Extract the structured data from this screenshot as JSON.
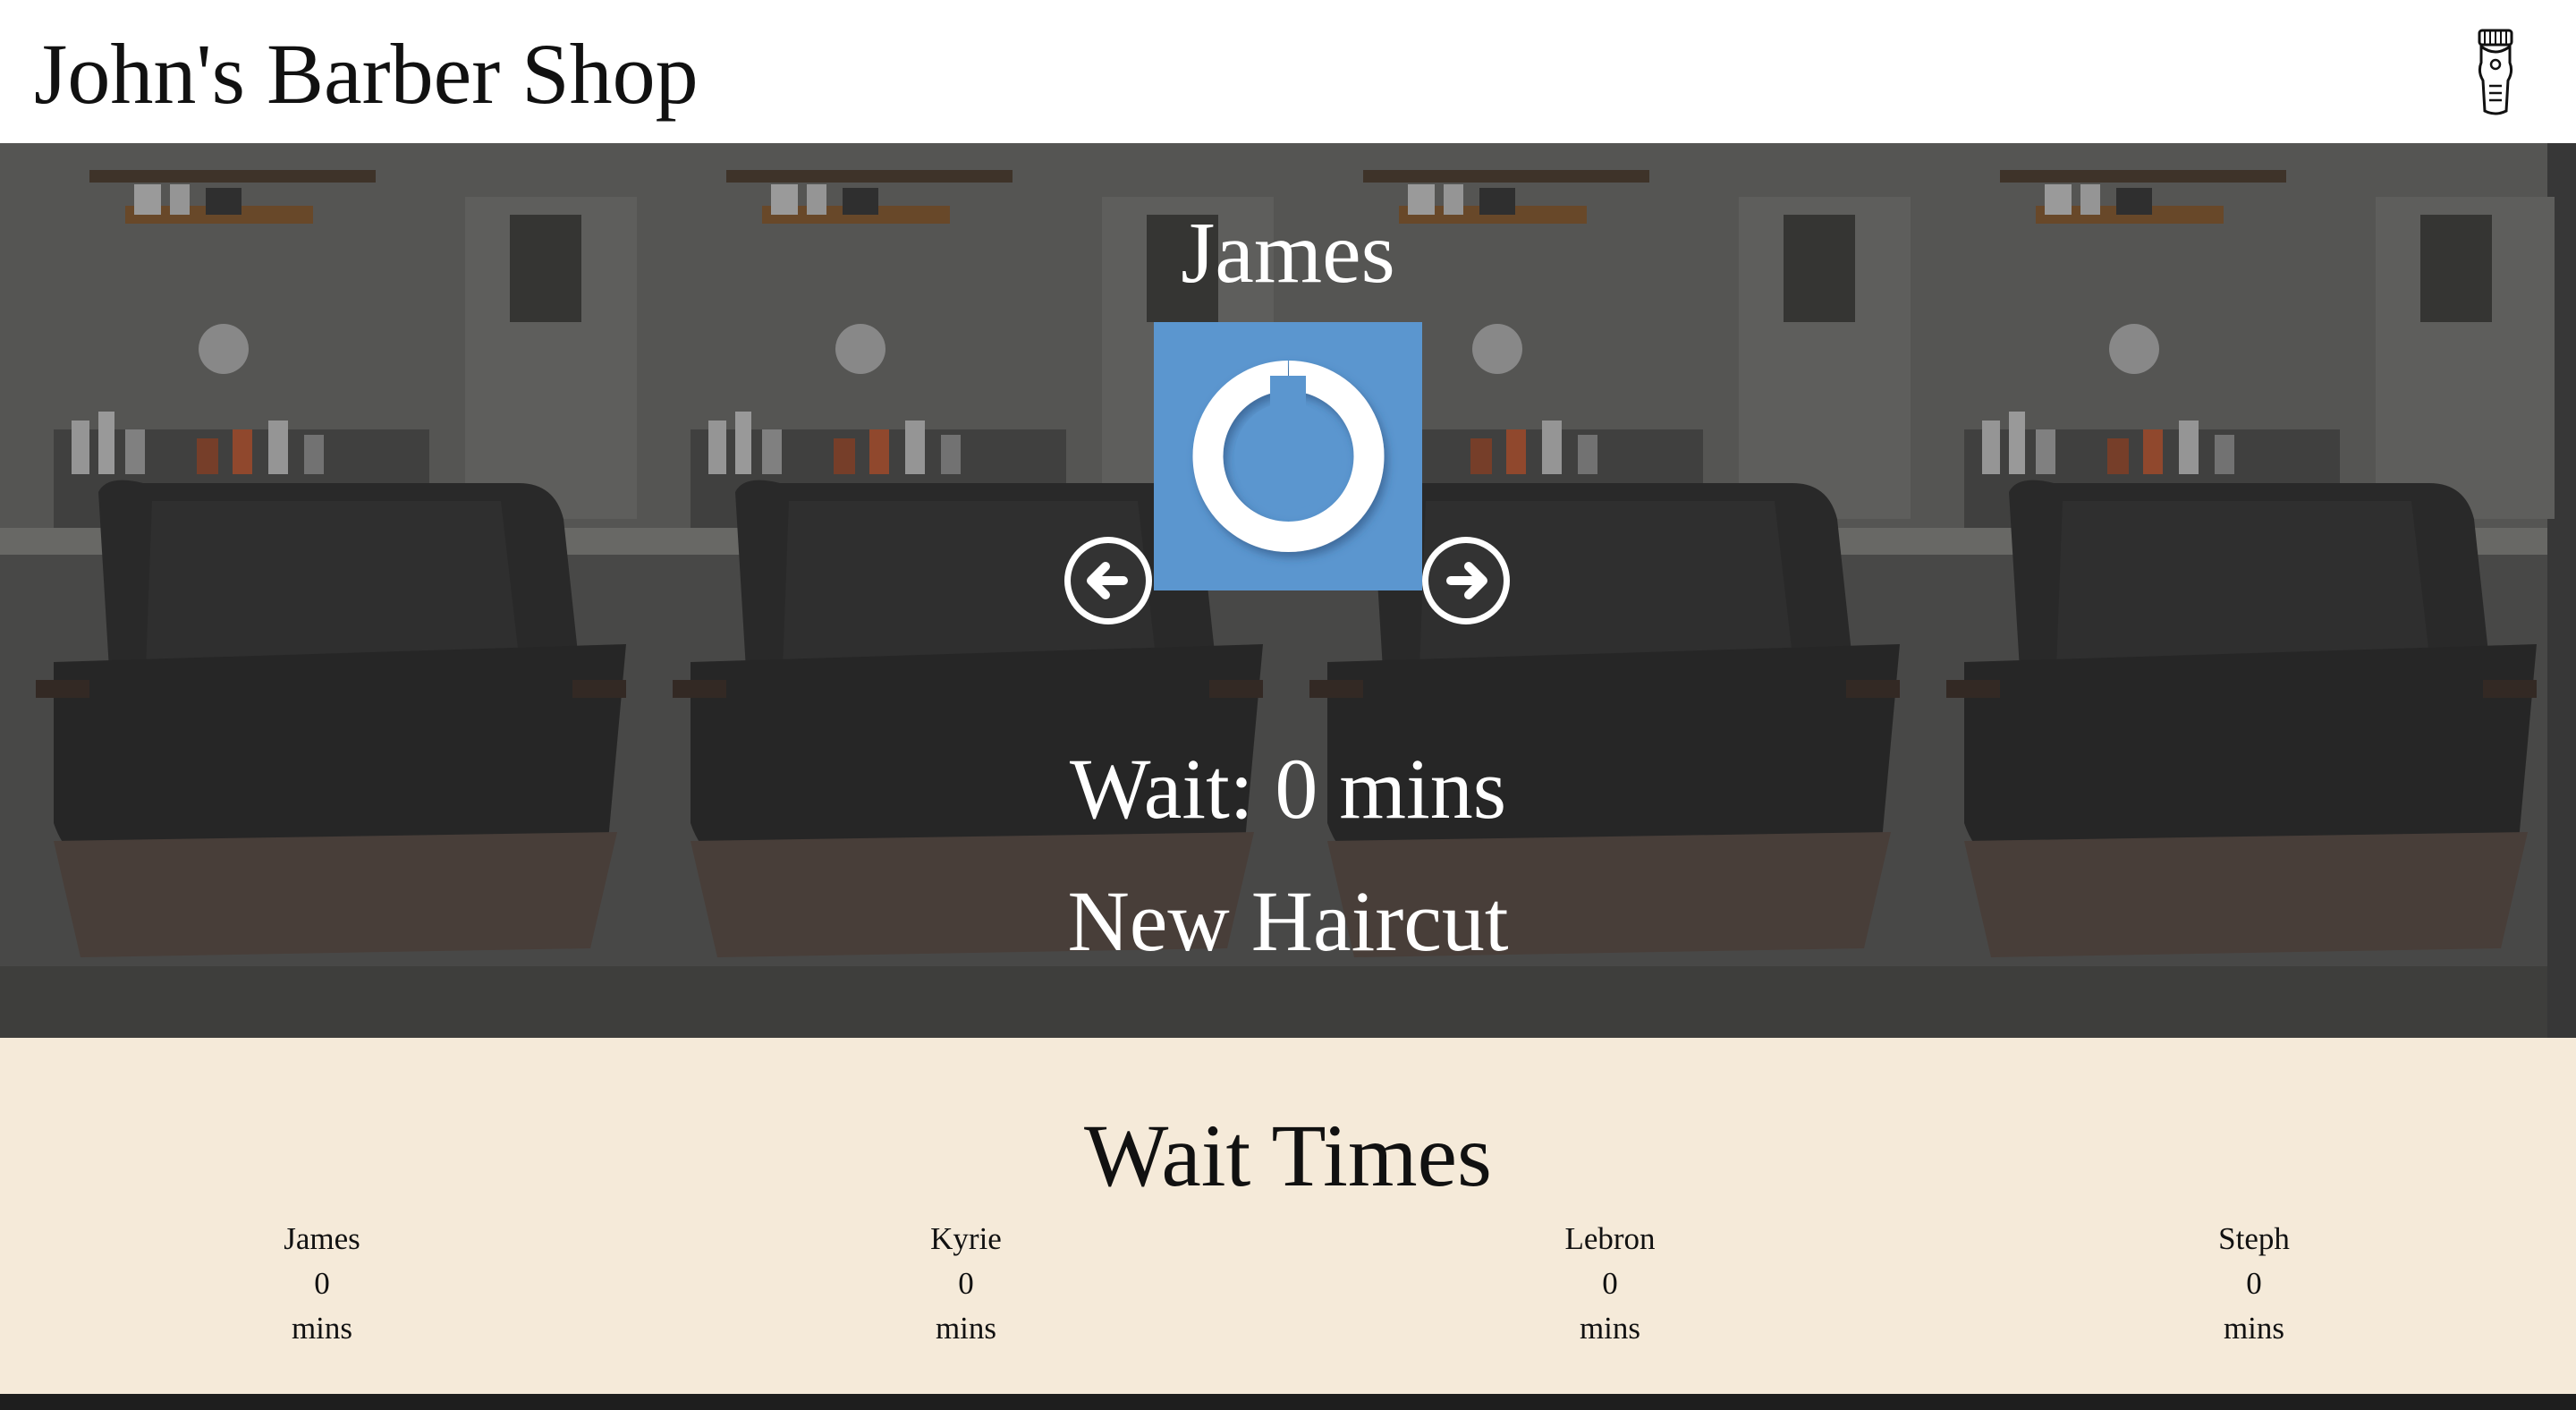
{
  "header": {
    "title": "John's Barber Shop",
    "icon": "clipper-icon"
  },
  "hero": {
    "barber_name": "James",
    "photo_icon": "power-icon",
    "wait_text": "Wait: 0 mins",
    "service_text": "New Haircut",
    "prev_icon": "arrow-left-icon",
    "next_icon": "arrow-right-icon"
  },
  "wait_times": {
    "title": "Wait Times",
    "barbers": [
      {
        "name": "James",
        "minutes": "0",
        "unit": "mins"
      },
      {
        "name": "Kyrie",
        "minutes": "0",
        "unit": "mins"
      },
      {
        "name": "Lebron",
        "minutes": "0",
        "unit": "mins"
      },
      {
        "name": "Steph",
        "minutes": "0",
        "unit": "mins"
      }
    ]
  },
  "colors": {
    "header_bg": "#ffffff",
    "section_bg": "#f5ead9",
    "photo_bg": "#5b96cf",
    "text_dark": "#111111",
    "text_light": "#ffffff"
  }
}
